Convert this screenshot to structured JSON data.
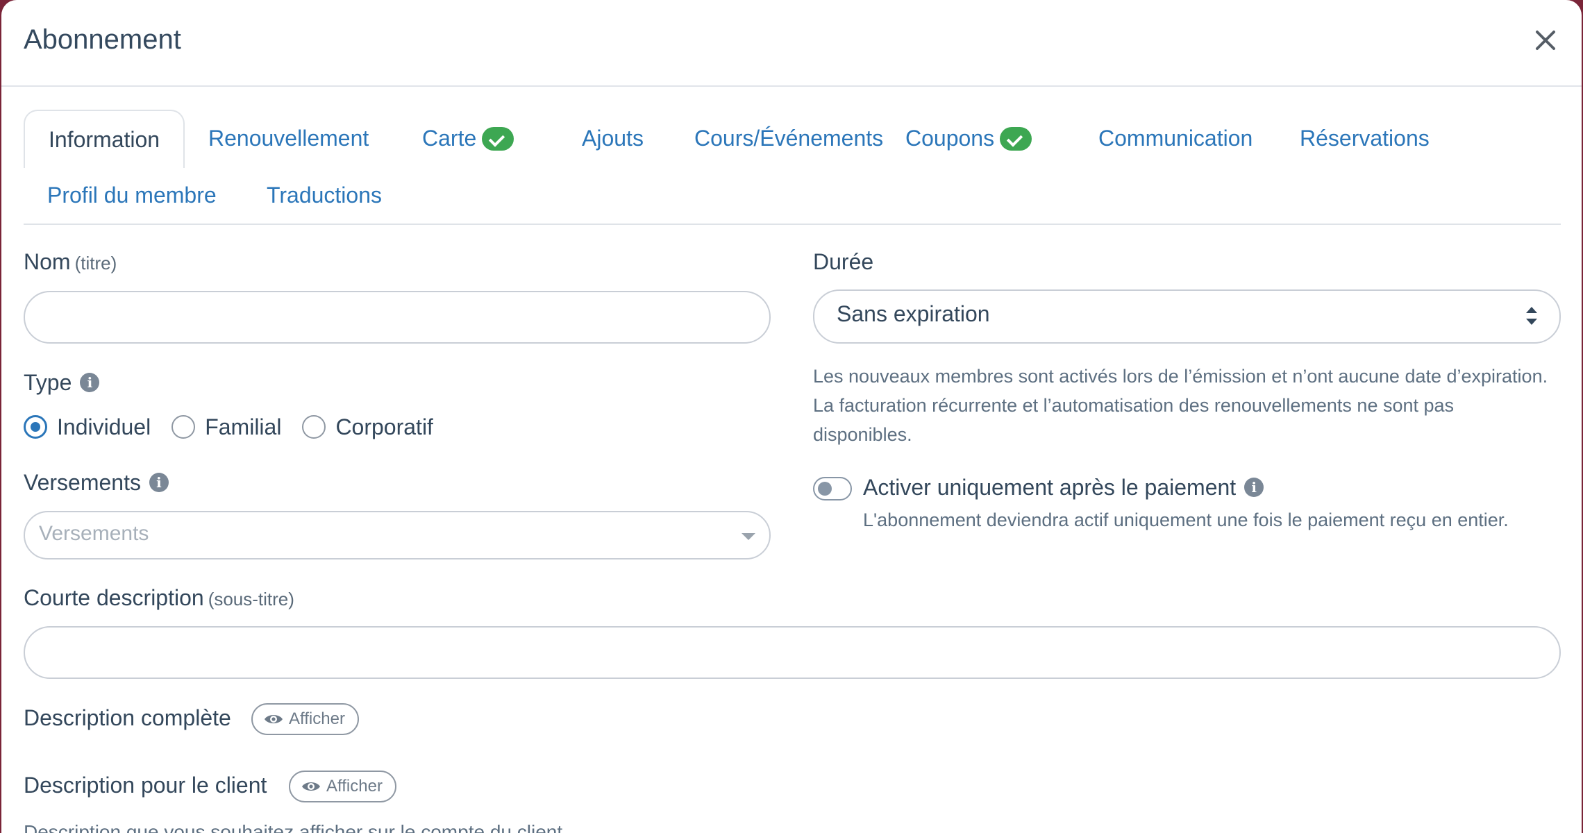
{
  "modal": {
    "title": "Abonnement"
  },
  "tabs": [
    {
      "label": "Information",
      "active": true,
      "check": false
    },
    {
      "label": "Renouvellement",
      "active": false,
      "check": false
    },
    {
      "label": "Carte",
      "active": false,
      "check": true
    },
    {
      "label": "Ajouts",
      "active": false,
      "check": false
    },
    {
      "label": "Cours/Événements",
      "active": false,
      "check": false
    },
    {
      "label": "Coupons",
      "active": false,
      "check": true
    },
    {
      "label": "Communication",
      "active": false,
      "check": false
    },
    {
      "label": "Réservations",
      "active": false,
      "check": false
    },
    {
      "label": "Profil du membre",
      "active": false,
      "check": false
    },
    {
      "label": "Traductions",
      "active": false,
      "check": false
    }
  ],
  "form": {
    "name_label": "Nom",
    "name_sub": "(titre)",
    "name_value": "",
    "type_label": "Type",
    "type_options": [
      "Individuel",
      "Familial",
      "Corporatif"
    ],
    "type_selected": "Individuel",
    "installments_label": "Versements",
    "installments_placeholder": "Versements",
    "short_desc_label": "Courte description",
    "short_desc_sub": "(sous-titre)",
    "short_desc_value": "",
    "full_desc_label": "Description complète",
    "show_label": "Afficher",
    "client_desc_label": "Description pour le client",
    "client_desc_help": "Description que vous souhaitez afficher sur le compte du client",
    "duration_label": "Durée",
    "duration_value": "Sans expiration",
    "duration_help": "Les nouveaux membres sont activés lors de l’émission et n’ont aucune date d’expiration. La facturation récurrente et l’automatisation des renouvellements ne sont pas disponibles.",
    "activate_label": "Activer uniquement après le paiement",
    "activate_help": "L'abonnement deviendra actif uniquement une fois le paiement reçu en entier.",
    "activate_on": false
  },
  "colors": {
    "accent": "#2b76b9",
    "success": "#3da752",
    "backdrop": "#7a2438",
    "text": "#33475b"
  }
}
